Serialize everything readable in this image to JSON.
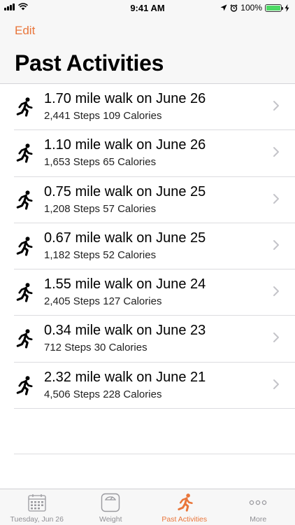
{
  "status_bar": {
    "time": "9:41 AM",
    "battery": "100%",
    "battery_level": 1.0
  },
  "nav": {
    "edit_label": "Edit",
    "title": "Past Activities"
  },
  "activities": [
    {
      "title": "1.70 mile walk on June 26",
      "subtitle": "2,441 Steps 109 Calories"
    },
    {
      "title": "1.10 mile walk on June 26",
      "subtitle": "1,653 Steps 65 Calories"
    },
    {
      "title": "0.75 mile walk on June 25",
      "subtitle": "1,208 Steps 57 Calories"
    },
    {
      "title": "0.67 mile walk on June 25",
      "subtitle": "1,182 Steps 52 Calories"
    },
    {
      "title": "1.55 mile walk on June 24",
      "subtitle": "2,405 Steps 127 Calories"
    },
    {
      "title": "0.34 mile walk on June 23",
      "subtitle": "712 Steps 30 Calories"
    },
    {
      "title": "2.32 mile walk on June 21",
      "subtitle": "4,506 Steps 228 Calories"
    }
  ],
  "tabs": [
    {
      "label": "Tuesday, Jun 26",
      "icon": "calendar-icon",
      "active": false
    },
    {
      "label": "Weight",
      "icon": "scale-icon",
      "active": false
    },
    {
      "label": "Past Activities",
      "icon": "runner-icon",
      "active": true
    },
    {
      "label": "More",
      "icon": "more-icon",
      "active": false
    }
  ],
  "colors": {
    "accent": "#e9763b",
    "inactive": "#8e8e93",
    "battery": "#4cd964"
  }
}
